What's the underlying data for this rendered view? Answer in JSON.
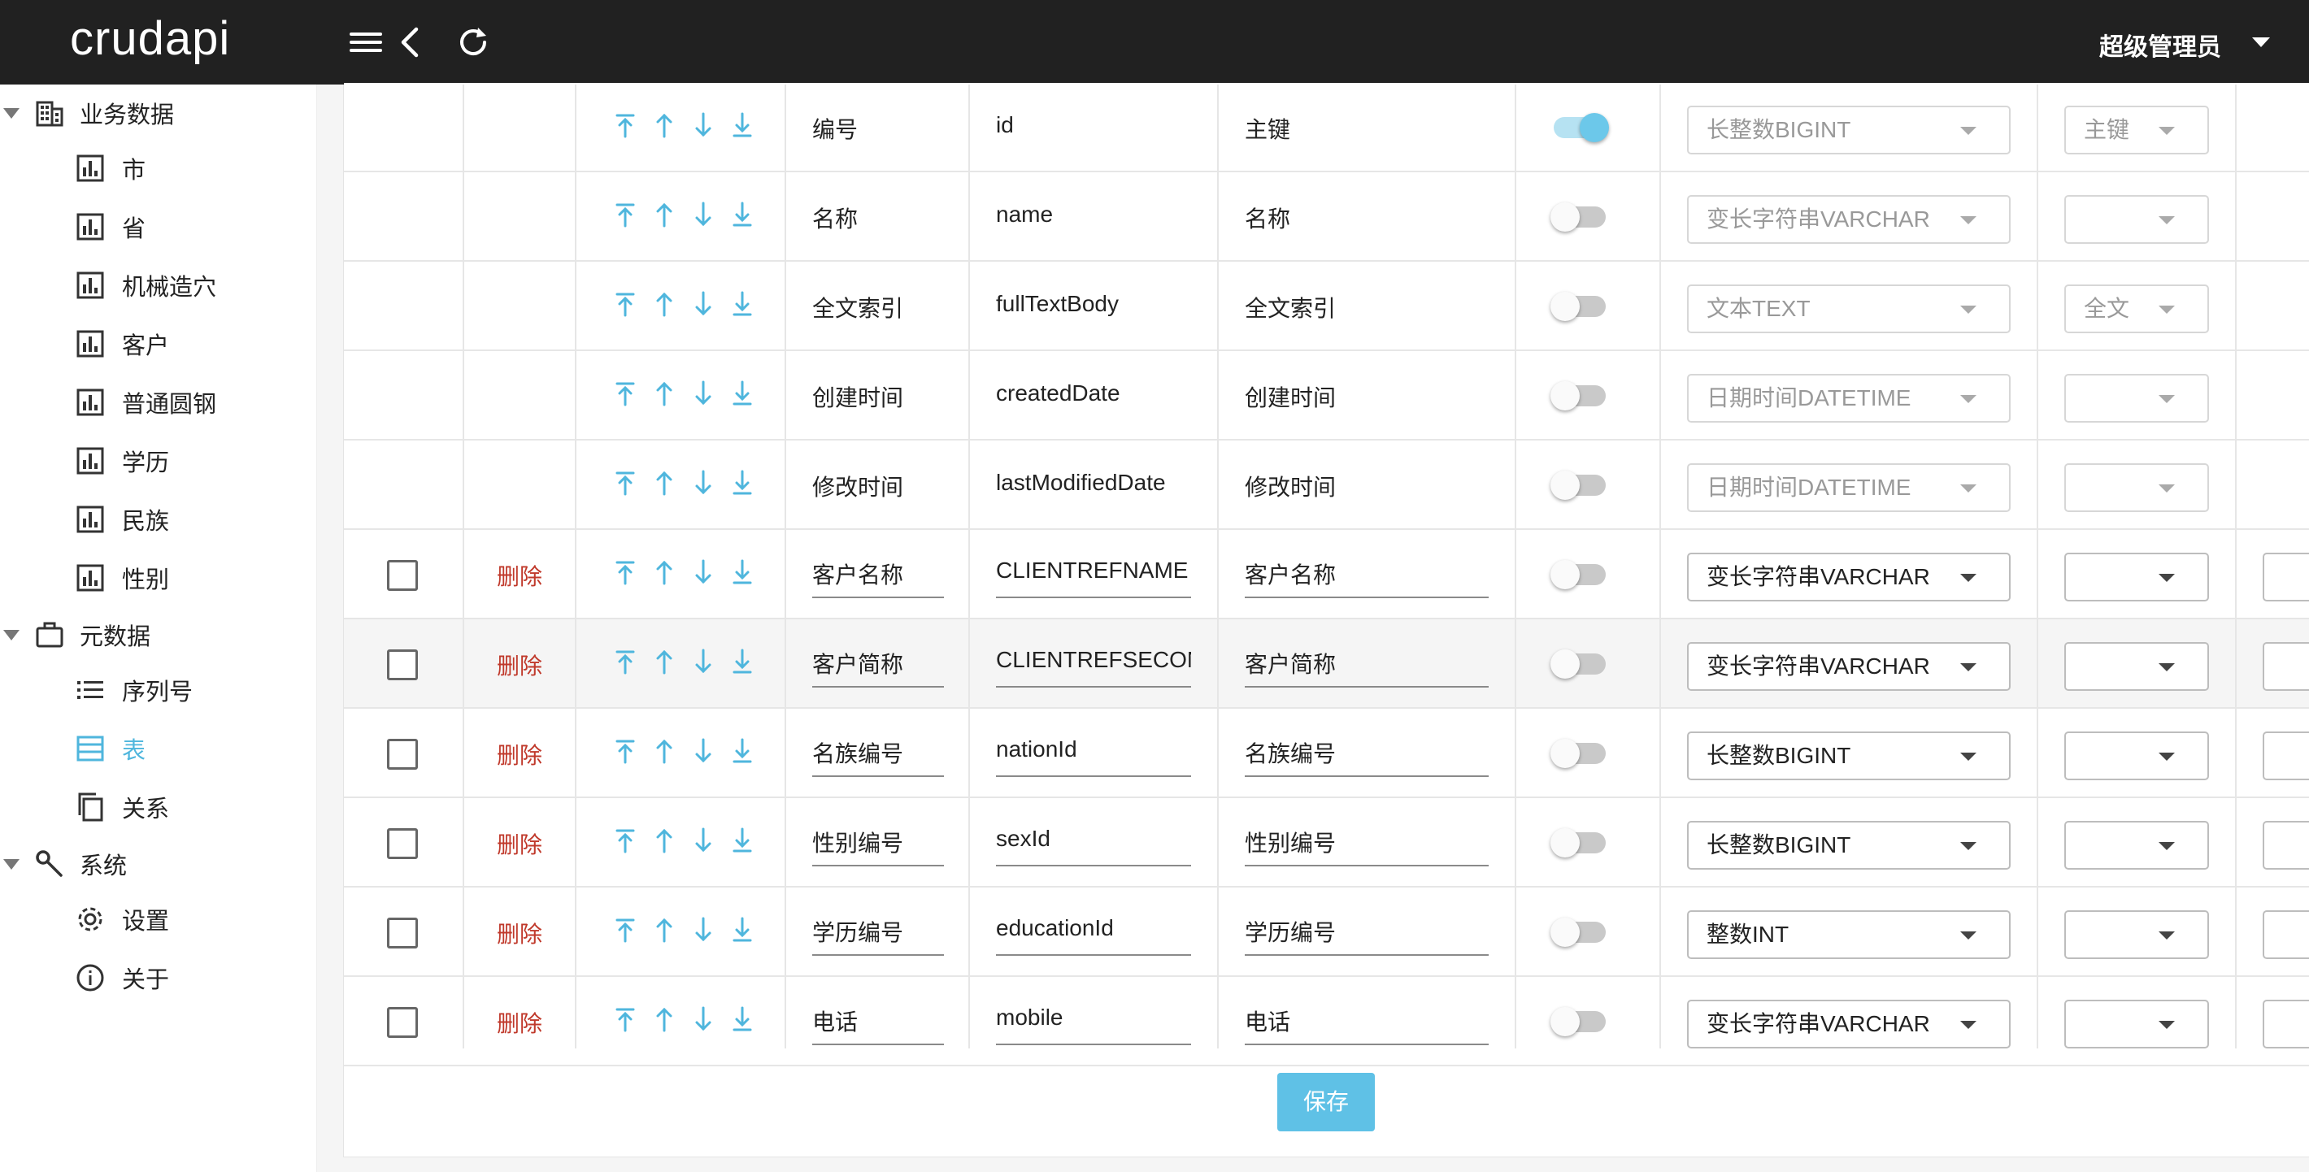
{
  "header": {
    "brand": "crudapi",
    "user": "超级管理员",
    "icons": [
      "menu-icon",
      "back-arrow-icon",
      "refresh-icon",
      "caret-down-icon"
    ]
  },
  "sidebar": {
    "sections": [
      {
        "label": "业务数据",
        "icon": "building-icon",
        "items": [
          {
            "label": "市",
            "icon": "chart-icon"
          },
          {
            "label": "省",
            "icon": "chart-icon"
          },
          {
            "label": "机械造穴",
            "icon": "chart-icon"
          },
          {
            "label": "客户",
            "icon": "chart-icon"
          },
          {
            "label": "普通圆钢",
            "icon": "chart-icon"
          },
          {
            "label": "学历",
            "icon": "chart-icon"
          },
          {
            "label": "民族",
            "icon": "chart-icon"
          },
          {
            "label": "性别",
            "icon": "chart-icon"
          }
        ]
      },
      {
        "label": "元数据",
        "icon": "briefcase-icon",
        "items": [
          {
            "label": "序列号",
            "icon": "list-icon"
          },
          {
            "label": "表",
            "icon": "table-icon",
            "active": true
          },
          {
            "label": "关系",
            "icon": "copy-icon"
          }
        ]
      },
      {
        "label": "系统",
        "icon": "wrench-icon",
        "items": [
          {
            "label": "设置",
            "icon": "gear-icon"
          },
          {
            "label": "关于",
            "icon": "info-icon"
          }
        ]
      }
    ]
  },
  "table": {
    "delete_label": "删除",
    "rows": [
      {
        "editable": false,
        "caption": "编号",
        "name": "id",
        "description": "主键",
        "switch_on": true,
        "data_type": "长整数BIGINT",
        "index_type": "主键"
      },
      {
        "editable": false,
        "caption": "名称",
        "name": "name",
        "description": "名称",
        "switch_on": false,
        "data_type": "变长字符串VARCHAR",
        "index_type": ""
      },
      {
        "editable": false,
        "caption": "全文索引",
        "name": "fullTextBody",
        "description": "全文索引",
        "switch_on": false,
        "data_type": "文本TEXT",
        "index_type": "全文"
      },
      {
        "editable": false,
        "caption": "创建时间",
        "name": "createdDate",
        "description": "创建时间",
        "switch_on": false,
        "data_type": "日期时间DATETIME",
        "index_type": ""
      },
      {
        "editable": false,
        "caption": "修改时间",
        "name": "lastModifiedDate",
        "description": "修改时间",
        "switch_on": false,
        "data_type": "日期时间DATETIME",
        "index_type": ""
      },
      {
        "editable": true,
        "caption": "客户名称",
        "name": "CLIENTREFNAME",
        "description": "客户名称",
        "switch_on": false,
        "data_type": "变长字符串VARCHAR",
        "index_type": ""
      },
      {
        "editable": true,
        "caption": "客户简称",
        "name": "CLIENTREFSECON",
        "description": "客户简称",
        "switch_on": false,
        "data_type": "变长字符串VARCHAR",
        "index_type": "",
        "highlight": true
      },
      {
        "editable": true,
        "caption": "名族编号",
        "name": "nationId",
        "description": "名族编号",
        "switch_on": false,
        "data_type": "长整数BIGINT",
        "index_type": ""
      },
      {
        "editable": true,
        "caption": "性别编号",
        "name": "sexId",
        "description": "性别编号",
        "switch_on": false,
        "data_type": "长整数BIGINT",
        "index_type": ""
      },
      {
        "editable": true,
        "caption": "学历编号",
        "name": "educationId",
        "description": "学历编号",
        "switch_on": false,
        "data_type": "整数INT",
        "index_type": ""
      },
      {
        "editable": true,
        "caption": "电话",
        "name": "mobile",
        "description": "电话",
        "switch_on": false,
        "data_type": "变长字符串VARCHAR",
        "index_type": ""
      }
    ]
  },
  "footer": {
    "save_label": "保存"
  },
  "colors": {
    "accent": "#5fc1e6",
    "delete": "#c0392b",
    "topbar": "#212121"
  }
}
